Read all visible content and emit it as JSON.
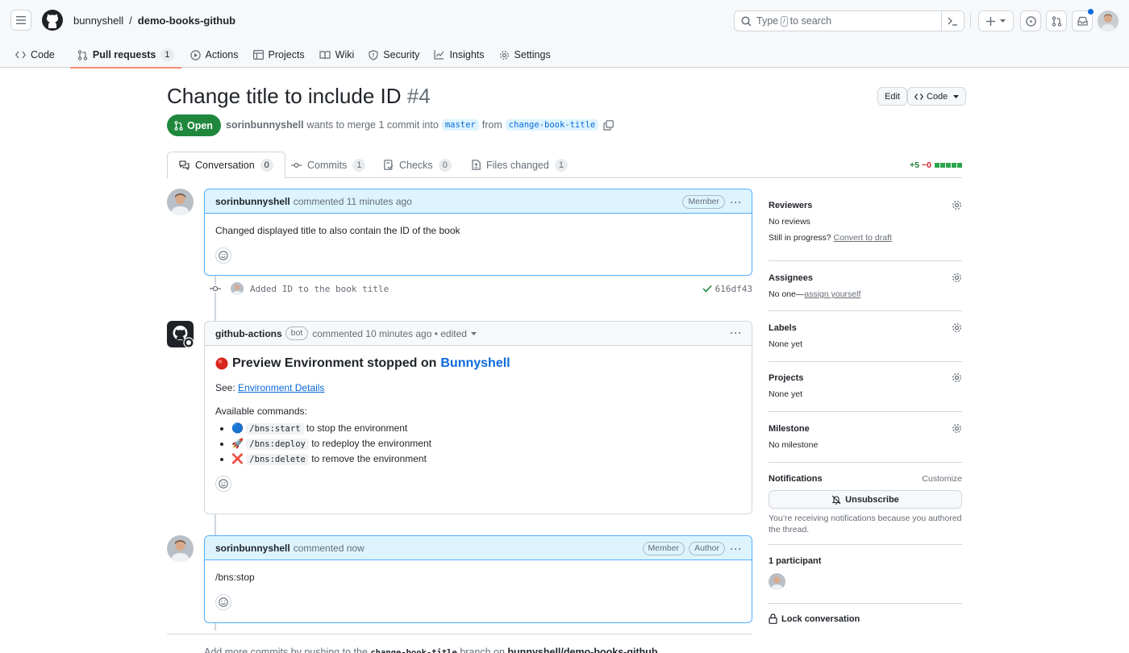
{
  "header": {
    "owner": "bunnyshell",
    "separator": "/",
    "repo": "demo-books-github",
    "search_prefix": "Type",
    "search_key": "/",
    "search_suffix": "to search"
  },
  "repo_nav": {
    "items": [
      {
        "label": "Code"
      },
      {
        "label": "Pull requests",
        "count": "1"
      },
      {
        "label": "Actions"
      },
      {
        "label": "Projects"
      },
      {
        "label": "Wiki"
      },
      {
        "label": "Security"
      },
      {
        "label": "Insights"
      },
      {
        "label": "Settings"
      }
    ]
  },
  "pr": {
    "title": "Change title to include ID",
    "number": "#4",
    "edit_label": "Edit",
    "code_label": "Code",
    "state": "Open",
    "author": "sorinbunnyshell",
    "merge_text": "wants to merge 1 commit into",
    "base_branch": "master",
    "from_text": "from",
    "head_branch": "change-book-title"
  },
  "tabs": [
    {
      "label": "Conversation",
      "count": "0"
    },
    {
      "label": "Commits",
      "count": "1"
    },
    {
      "label": "Checks",
      "count": "0"
    },
    {
      "label": "Files changed",
      "count": "1"
    }
  ],
  "diffstat": {
    "additions": "+5",
    "deletions": "−0"
  },
  "timeline": {
    "comment1": {
      "author": "sorinbunnyshell",
      "action": "commented 11 minutes ago",
      "badge": "Member",
      "body": "Changed displayed title to also contain the ID of the book"
    },
    "commit": {
      "message": "Added ID to the book title",
      "sha": "616df43"
    },
    "comment2": {
      "author": "github-actions",
      "bot_badge": "bot",
      "action": "commented 10 minutes ago • edited",
      "heading_prefix": "Preview Environment stopped on",
      "heading_link": "Bunnyshell",
      "see_label": "See:",
      "see_link": "Environment Details",
      "commands_label": "Available commands:",
      "commands": [
        {
          "emoji": "🔵",
          "code": "/bns:start",
          "text": "to stop the environment"
        },
        {
          "emoji": "🚀",
          "code": "/bns:deploy",
          "text": "to redeploy the environment"
        },
        {
          "emoji": "❌",
          "code": "/bns:delete",
          "text": "to remove the environment"
        }
      ]
    },
    "comment3": {
      "author": "sorinbunnyshell",
      "action": "commented now",
      "badge1": "Member",
      "badge2": "Author",
      "body": "/bns:stop"
    }
  },
  "footnote": {
    "prefix": "Add more commits by pushing to the",
    "branch": "change-book-title",
    "middle": "branch on",
    "repo": "bunnyshell/demo-books-github"
  },
  "sidebar": {
    "reviewers_title": "Reviewers",
    "reviewers_value": "No reviews",
    "in_progress": "Still in progress?",
    "convert_draft": "Convert to draft",
    "assignees_title": "Assignees",
    "assignees_value": "No one—",
    "assign_yourself": "assign yourself",
    "labels_title": "Labels",
    "labels_value": "None yet",
    "projects_title": "Projects",
    "projects_value": "None yet",
    "milestone_title": "Milestone",
    "milestone_value": "No milestone",
    "notifications_title": "Notifications",
    "customize": "Customize",
    "unsubscribe": "Unsubscribe",
    "notif_reason": "You’re receiving notifications because you authored the thread.",
    "participants": "1 participant",
    "lock": "Lock conversation"
  },
  "colors": {
    "accent": "#0969da",
    "open_green": "#1f883d",
    "active_tab_underline": "#fd8c73"
  }
}
